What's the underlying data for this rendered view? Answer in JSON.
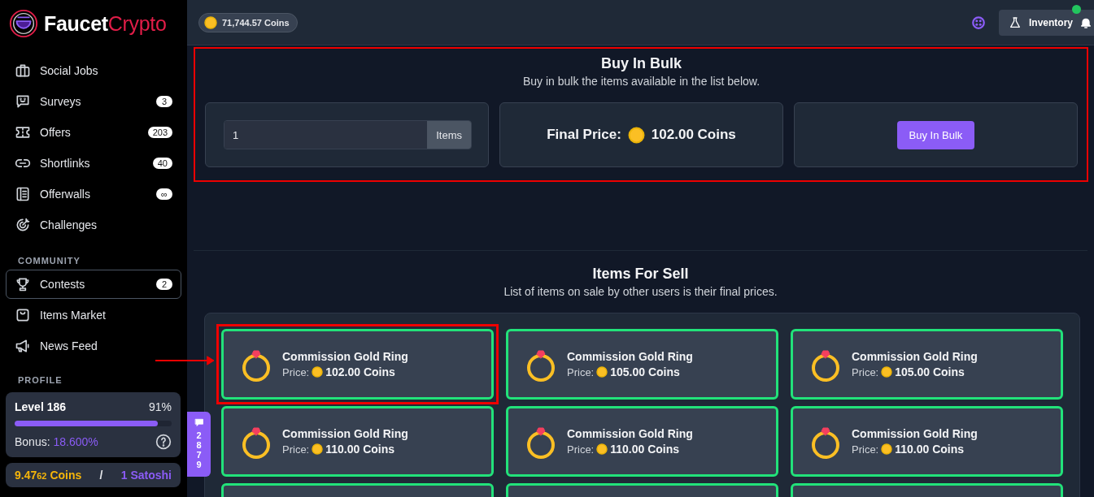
{
  "sidebar": {
    "logo": {
      "word_1": "Faucet",
      "word_2": "Crypto"
    },
    "nav": [
      {
        "label": "Social Jobs",
        "selected": false
      },
      {
        "label": "Surveys",
        "badge": "3",
        "selected": false
      },
      {
        "label": "Offers",
        "badge": "203",
        "selected": false
      },
      {
        "label": "Shortlinks",
        "badge": "40",
        "selected": false
      },
      {
        "label": "Offerwalls",
        "badge": "∞",
        "selected": false
      },
      {
        "label": "Challenges",
        "selected": false
      }
    ],
    "community_heading": "COMMUNITY",
    "community": [
      {
        "label": "Contests",
        "badge": "2",
        "selected": true
      },
      {
        "label": "Items Market",
        "selected": false
      },
      {
        "label": "News Feed",
        "selected": false
      }
    ],
    "profile_heading": "PROFILE",
    "profile": {
      "level_label": "Level 186",
      "percent": "91%",
      "level": 0.91,
      "bonus_label": "Bonus:",
      "bonus_value": "18.600%"
    },
    "rate": {
      "coins_main": "9.47",
      "coins_small": "62",
      "coins_unit": "Coins",
      "separator": "/",
      "satoshi": "1 Satoshi"
    }
  },
  "chat_tab": {
    "count": "2879"
  },
  "topbar": {
    "balance": "71,744.57 Coins",
    "inventory_button": "Inventory",
    "notification_dot": true
  },
  "bulk": {
    "title": "Buy In Bulk",
    "subtitle": "Buy in bulk the items available in the list below.",
    "highlighted": true,
    "quantity": {
      "value": "1",
      "suffix": "Items"
    },
    "final_price_label": "Final Price:",
    "final_price": "102.00 Coins",
    "button": "Buy In Bulk"
  },
  "items_section": {
    "title": "Items For Sell",
    "subtitle": "List of items on sale by other users is their final prices.",
    "items": [
      {
        "kind": "full",
        "name": "Commission Gold Ring",
        "price_label": "Price:",
        "price": "102.00 Coins",
        "highlighted": true
      },
      {
        "kind": "full",
        "name": "Commission Gold Ring",
        "price_label": "Price:",
        "price": "105.00 Coins",
        "highlighted": false
      },
      {
        "kind": "full",
        "name": "Commission Gold Ring",
        "price_label": "Price:",
        "price": "105.00 Coins",
        "highlighted": false
      },
      {
        "kind": "full",
        "name": "Commission Gold Ring",
        "price_label": "Price:",
        "price": "110.00 Coins",
        "highlighted": false
      },
      {
        "kind": "full",
        "name": "Commission Gold Ring",
        "price_label": "Price:",
        "price": "110.00 Coins",
        "highlighted": false
      },
      {
        "kind": "full",
        "name": "Commission Gold Ring",
        "price_label": "Price:",
        "price": "110.00 Coins",
        "highlighted": false
      },
      {
        "kind": "partial"
      },
      {
        "kind": "partial"
      },
      {
        "kind": "partial"
      }
    ]
  }
}
